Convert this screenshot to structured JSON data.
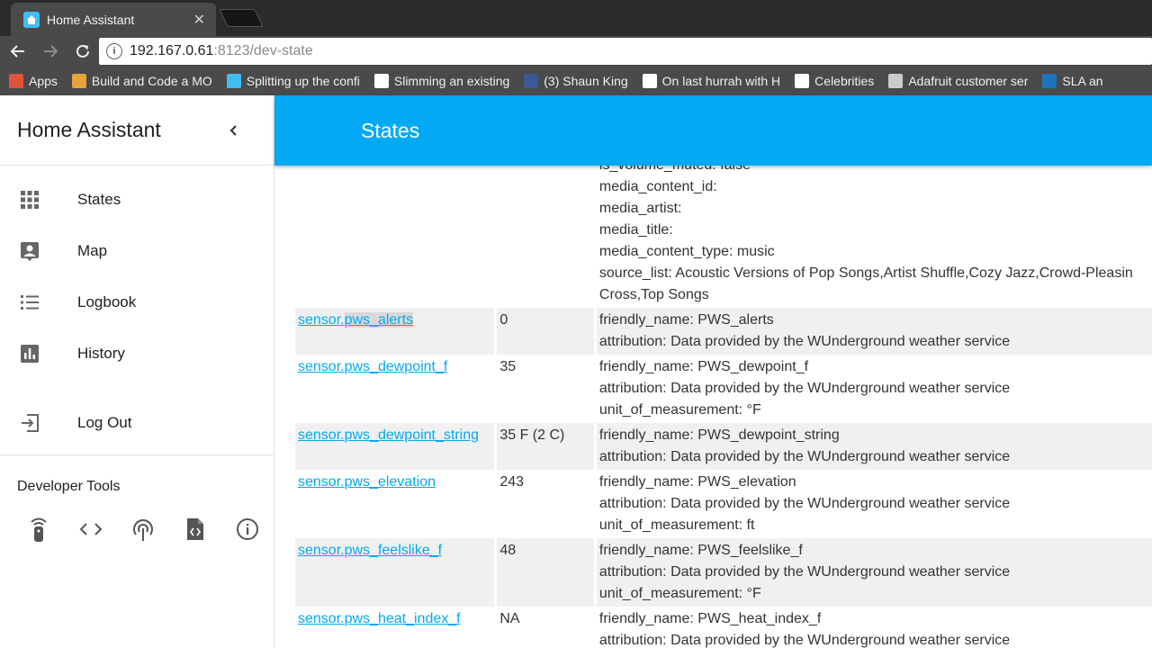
{
  "browser": {
    "tab_title": "Home Assistant",
    "tab_close": "✕",
    "url_host": "192.167.0.61",
    "url_rest": ":8123/dev-state",
    "bookmarks": [
      {
        "label": "Apps",
        "icon": "apps-grid-icon",
        "color": "#e0533b"
      },
      {
        "label": "Build and Code a MO",
        "icon": "character-icon",
        "color": "#e8a33c"
      },
      {
        "label": "Splitting up the confi",
        "icon": "home-assistant-icon",
        "color": "#41bdf5"
      },
      {
        "label": "Slimming an existing",
        "icon": "page-icon",
        "color": "#ffffff"
      },
      {
        "label": "(3) Shaun King",
        "icon": "facebook-icon",
        "color": "#3b5998"
      },
      {
        "label": "On last hurrah with H",
        "icon": "reddit-icon",
        "color": "#ffffff"
      },
      {
        "label": "Celebrities",
        "icon": "page-icon",
        "color": "#ffffff"
      },
      {
        "label": "Adafruit customer ser",
        "icon": "adafruit-icon",
        "color": "#cccccc"
      },
      {
        "label": "SLA an",
        "icon": "sla-icon",
        "color": "#1e73be"
      }
    ]
  },
  "sidebar": {
    "title": "Home Assistant",
    "items": [
      {
        "label": "States"
      },
      {
        "label": "Map"
      },
      {
        "label": "Logbook"
      },
      {
        "label": "History"
      },
      {
        "label": "Log Out"
      }
    ],
    "devtools_title": "Developer Tools"
  },
  "appbar": {
    "title": "States"
  },
  "partial_row": {
    "attributes": [
      "is_volume_muted: false",
      "media_content_id:",
      "media_artist:",
      "media_title:",
      "media_content_type: music",
      "source_list: Acoustic Versions of Pop Songs,Artist Shuffle,Cozy Jazz,Crowd-Pleasin",
      "Cross,Top Songs"
    ]
  },
  "rows": [
    {
      "entity_prefix": "sensor.",
      "entity_suffix": "pws_alerts",
      "state": "0",
      "attributes": [
        "friendly_name: PWS_alerts",
        "attribution: Data provided by the WUnderground weather service"
      ]
    },
    {
      "entity_prefix": "sensor.",
      "entity_suffix": "pws_dewpoint_f",
      "state": "35",
      "attributes": [
        "friendly_name: PWS_dewpoint_f",
        "attribution: Data provided by the WUnderground weather service",
        "unit_of_measurement: °F"
      ]
    },
    {
      "entity_prefix": "sensor.",
      "entity_suffix": "pws_dewpoint_string",
      "state": "35 F (2 C)",
      "attributes": [
        "friendly_name: PWS_dewpoint_string",
        "attribution: Data provided by the WUnderground weather service"
      ]
    },
    {
      "entity_prefix": "sensor.",
      "entity_suffix": "pws_elevation",
      "state": "243",
      "attributes": [
        "friendly_name: PWS_elevation",
        "attribution: Data provided by the WUnderground weather service",
        "unit_of_measurement: ft"
      ]
    },
    {
      "entity_prefix": "sensor.",
      "entity_suffix": "pws_feelslike_f",
      "state": "48",
      "attributes": [
        "friendly_name: PWS_feelslike_f",
        "attribution: Data provided by the WUnderground weather service",
        "unit_of_measurement: °F"
      ]
    },
    {
      "entity_prefix": "sensor.",
      "entity_suffix": "pws_heat_index_f",
      "state": "NA",
      "attributes": [
        "friendly_name: PWS_heat_index_f",
        "attribution: Data provided by the WUnderground weather service"
      ]
    }
  ]
}
